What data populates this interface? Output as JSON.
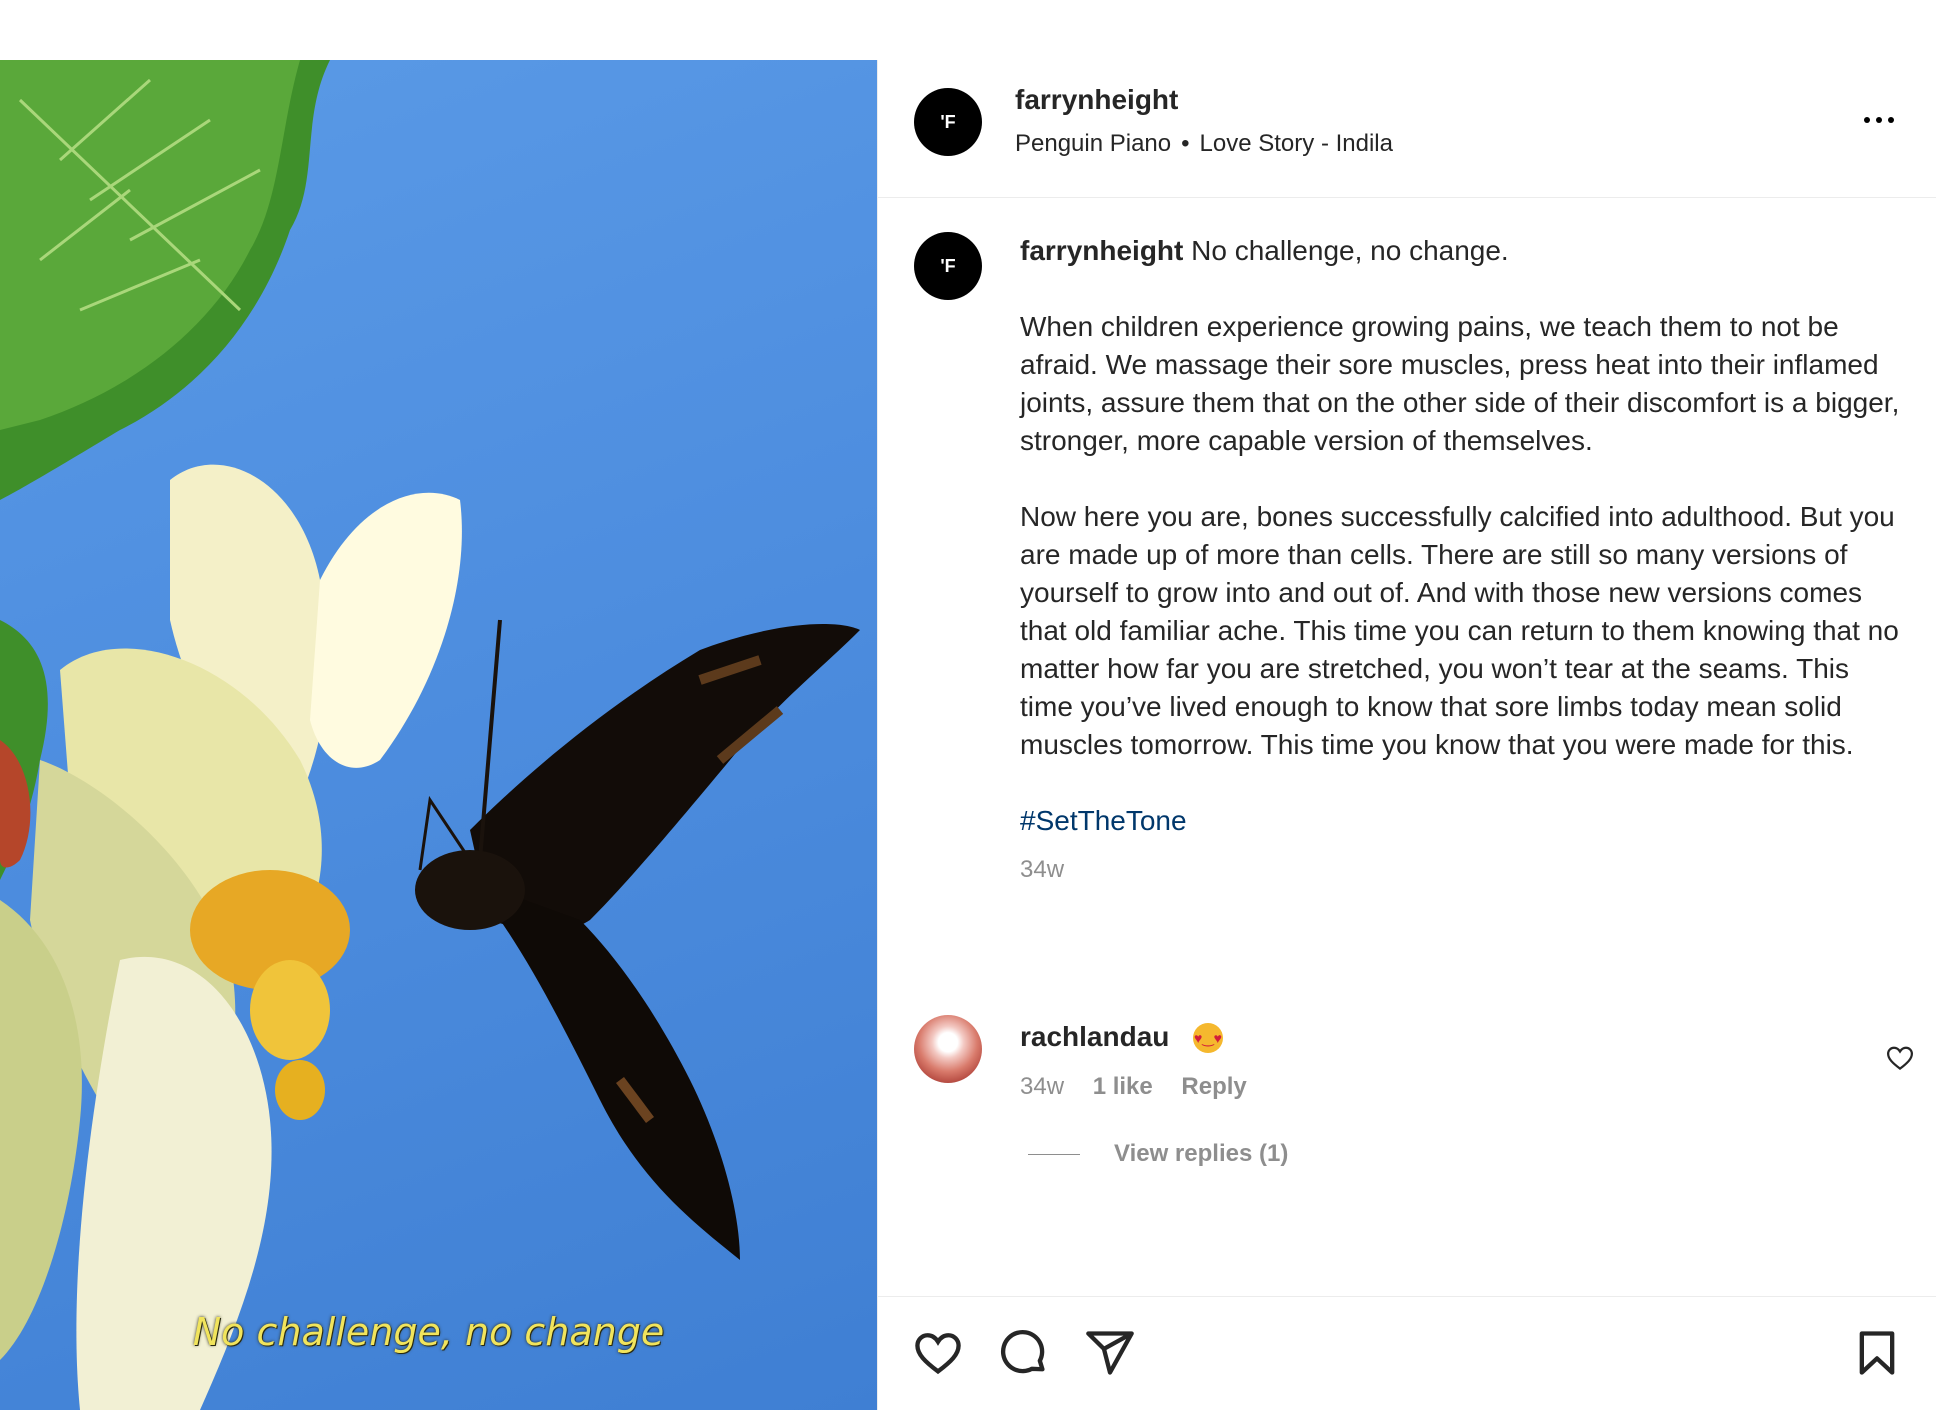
{
  "media": {
    "overlay_caption": "No challenge, no change"
  },
  "header": {
    "avatar_letter": "'F",
    "username": "farrynheight",
    "audio_artist": "Penguin Piano",
    "audio_separator": "•",
    "audio_track": "Love Story - Indila",
    "more_icon": "more-horizontal-icon"
  },
  "caption": {
    "avatar_letter": "'F",
    "username": "farrynheight",
    "first_line": "No challenge, no change.",
    "paragraph_1": "When children experience growing pains, we teach them to not be afraid. We massage their sore muscles, press heat into their inflamed joints, assure them that on the other side of their discomfort is a bigger, stronger, more capable version of themselves.",
    "paragraph_2": "Now here you are, bones successfully calcified into adulthood. But you are made up of more than cells. There are still so many versions of yourself to grow into and out of. And with those new versions comes that old familiar ache. This time you can return to them knowing that no matter how far you are stretched, you won’t tear at the seams. This time you’ve lived enough to know that sore limbs today mean solid muscles tomorrow. This time you know that you were made for this.",
    "hashtag": "#SetTheTone",
    "time": "34w"
  },
  "comment": {
    "username": "rachlandau",
    "emoji": "heart-eyes-emoji",
    "time": "34w",
    "likes": "1 like",
    "reply_label": "Reply",
    "view_replies": "View replies (1)"
  },
  "actions": {
    "like_icon": "heart-icon",
    "comment_icon": "comment-icon",
    "share_icon": "share-icon",
    "save_icon": "bookmark-icon"
  },
  "colors": {
    "link": "#00376b",
    "muted": "#8e8e8e",
    "text": "#262626",
    "overlay_caption": "#f1e45c"
  }
}
